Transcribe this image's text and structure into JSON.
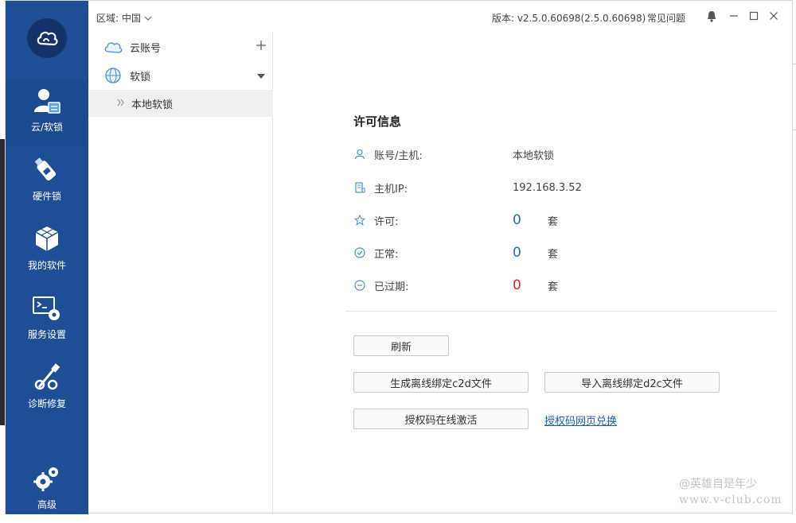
{
  "topbar": {
    "region_label": "区域:",
    "region_value": "中国",
    "version": "版本: v2.5.0.60698(2.5.0.60698)",
    "faq": "常见问题"
  },
  "sidebar": {
    "items": [
      {
        "label": "云/软锁",
        "icon": "user-card-icon",
        "active": true
      },
      {
        "label": "硬件锁",
        "icon": "usb-key-icon"
      },
      {
        "label": "我的软件",
        "icon": "cubes-icon"
      },
      {
        "label": "服务设置",
        "icon": "terminal-gear-icon"
      },
      {
        "label": "诊断修复",
        "icon": "wrench-screwdriver-icon"
      },
      {
        "label": "高级",
        "icon": "gears-icon"
      }
    ]
  },
  "tree": {
    "cloud_account": "云账号",
    "soft_lock": "软锁",
    "local_soft_lock": "本地软锁"
  },
  "license": {
    "title": "许可信息",
    "rows": [
      {
        "label": "账号/主机:",
        "value": "本地软锁"
      },
      {
        "label": "主机IP:",
        "value": "192.168.3.52"
      },
      {
        "label": "许可:",
        "value": "0",
        "unit": "套"
      },
      {
        "label": "正常:",
        "value": "0",
        "unit": "套"
      },
      {
        "label": "已过期:",
        "value": "0",
        "unit": "套"
      }
    ]
  },
  "actions": {
    "refresh": "刷新",
    "gen_c2d": "生成离线绑定c2d文件",
    "import_d2c": "导入离线绑定d2c文件",
    "online_activate": "授权码在线激活",
    "web_exchange": "授权码网页兑换"
  },
  "watermark": {
    "line1": "@英雄自是年少",
    "line2": "www.v-club.com"
  },
  "colors": {
    "sidebar": "#1e4f96",
    "accent": "#1a6fc4",
    "expired": "#e02020"
  }
}
